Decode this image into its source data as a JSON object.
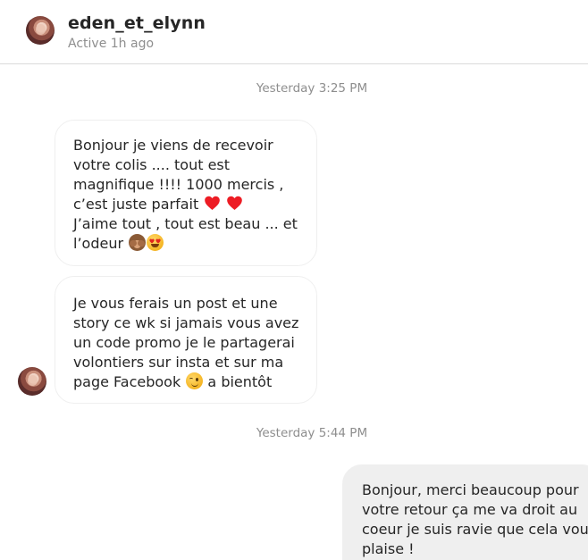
{
  "header": {
    "username": "eden_et_elynn",
    "status": "Active 1h ago"
  },
  "timestamps": [
    "Yesterday 3:25 PM",
    "Yesterday 5:44 PM"
  ],
  "messages": [
    {
      "sender": "eden_et_elynn",
      "lines": [
        "Bonjour je viens de recevoir",
        "votre colis .... tout est",
        "magnifique !!!! 1000 mercis ,",
        "c’est juste parfait",
        "J’aime tout , tout est beau ... et",
        "l’odeur"
      ],
      "emojis": [
        "red-heart",
        "red-heart",
        "see-no-evil-monkey",
        "heart-eyes-face"
      ]
    },
    {
      "sender": "eden_et_elynn",
      "lines": [
        "Je vous ferais un post et une",
        "story ce wk si jamais vous avez",
        "un code promo je le partagerai",
        "volontiers sur insta et sur ma",
        "page Facebook",
        "a bientôt"
      ],
      "emojis": [
        "winking-face"
      ]
    },
    {
      "sender": "me",
      "lines": [
        "Bonjour, merci beaucoup pour",
        "votre retour ça me va droit au",
        "coeur je suis ravie que cela vous",
        "plaise !"
      ]
    }
  ],
  "colors": {
    "incoming_border": "#efefef",
    "outgoing_bg": "#efefef",
    "muted_text": "#8e8e8e",
    "heart": "#ed1c24"
  }
}
